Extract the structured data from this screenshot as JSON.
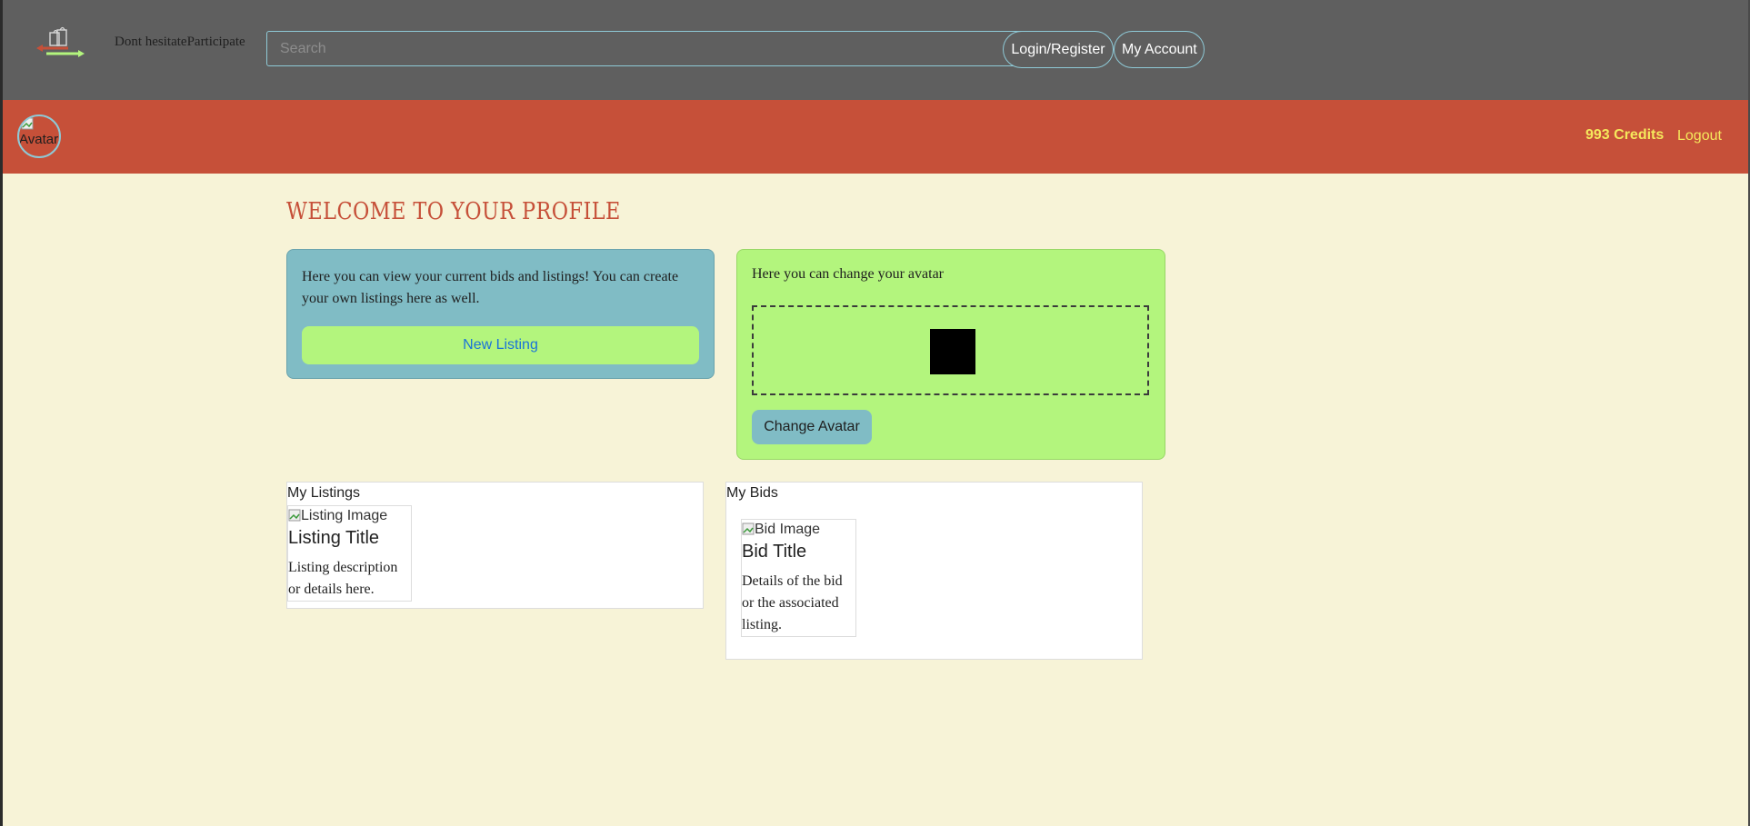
{
  "header": {
    "slogan": "Dont hesitateParticipate",
    "search": {
      "placeholder": "Search",
      "value": ""
    },
    "login_label": "Login/Register",
    "account_label": "My Account"
  },
  "userbar": {
    "avatar_alt": "Avatar",
    "credits": "993 Credits",
    "logout_label": "Logout"
  },
  "profile": {
    "title": "WELCOME TO YOUR PROFILE",
    "listings_card": {
      "text": "Here you can view your current bids and listings! You can create your own listings here as well.",
      "button_label": "New Listing"
    },
    "avatar_card": {
      "text": "Here you can change your avatar",
      "button_label": "Change Avatar"
    }
  },
  "my_listings": {
    "title": "My Listings",
    "items": [
      {
        "image_alt": "Listing Image",
        "title": "Listing Title",
        "description": "Listing description or details here."
      }
    ]
  },
  "my_bids": {
    "title": "My Bids",
    "items": [
      {
        "image_alt": "Bid Image",
        "title": "Bid Title",
        "description": "Details of the bid or the associated listing."
      }
    ]
  },
  "colors": {
    "topbar": "#5f5f5f",
    "accent_red": "#c65039",
    "credits_yellow": "#f5e85c",
    "blue_card": "#80bcc5",
    "green_card": "#b3f57d",
    "background": "#f7f3d7"
  },
  "icons": [
    "logo-icon",
    "broken-image-icon"
  ]
}
